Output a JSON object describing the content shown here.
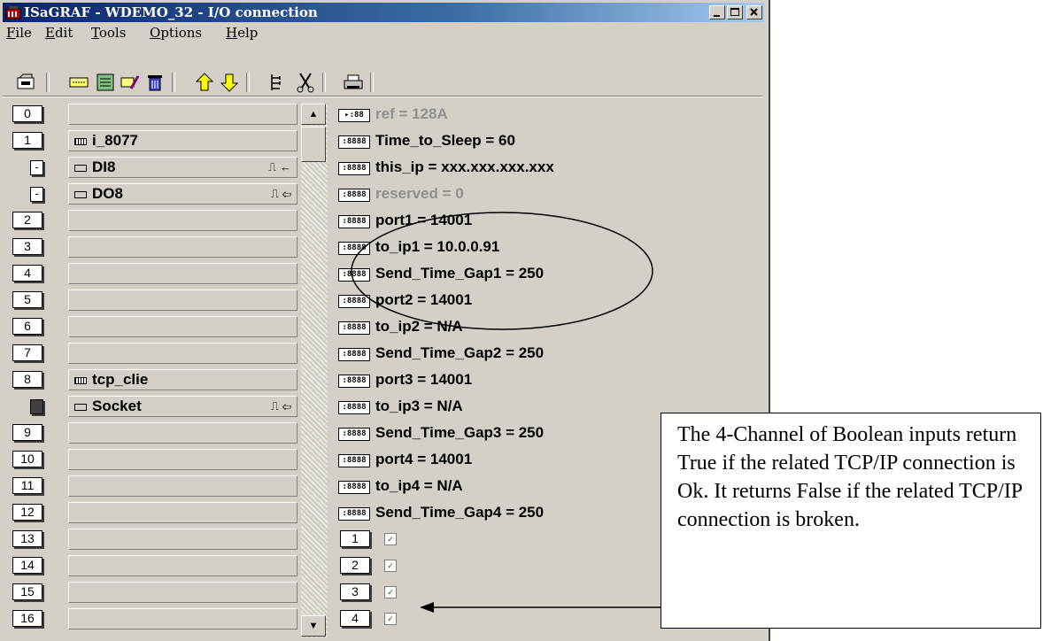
{
  "window": {
    "title": "ISaGRAF - WDEMO_32 - I/O connection",
    "caption_buttons": [
      "minimize-icon",
      "maximize-icon",
      "close-icon"
    ]
  },
  "menu": [
    "File",
    "Edit",
    "Tools",
    "Options",
    "Help"
  ],
  "toolbar": [
    "open-icon",
    "board-icon",
    "variables-icon",
    "edit-icon",
    "delete-icon",
    "up-arrow-icon",
    "down-arrow-icon",
    "tree-icon",
    "cut-icon",
    "print-icon"
  ],
  "slots": [
    {
      "num": "0",
      "name": ""
    },
    {
      "num": "1",
      "name": "i_8077"
    },
    {
      "num": "-",
      "name": "DI8"
    },
    {
      "num": "-",
      "name": "DO8"
    },
    {
      "num": "2",
      "name": ""
    },
    {
      "num": "3",
      "name": ""
    },
    {
      "num": "4",
      "name": ""
    },
    {
      "num": "5",
      "name": ""
    },
    {
      "num": "6",
      "name": ""
    },
    {
      "num": "7",
      "name": ""
    },
    {
      "num": "8",
      "name": "tcp_clie"
    },
    {
      "num": "",
      "name": "Socket"
    },
    {
      "num": "9",
      "name": ""
    },
    {
      "num": "10",
      "name": ""
    },
    {
      "num": "11",
      "name": ""
    },
    {
      "num": "12",
      "name": ""
    },
    {
      "num": "13",
      "name": ""
    },
    {
      "num": "14",
      "name": ""
    },
    {
      "num": "15",
      "name": ""
    },
    {
      "num": "16",
      "name": ""
    }
  ],
  "variables": [
    "ref = 128A",
    "Time_to_Sleep = 60",
    "this_ip = xxx.xxx.xxx.xxx",
    "reserved = 0",
    "port1 = 14001",
    "to_ip1 = 10.0.0.91",
    "Send_Time_Gap1 = 250",
    "port2 = 14001",
    "to_ip2 = N/A",
    "Send_Time_Gap2 = 250",
    "port3 = 14001",
    "to_ip3 = N/A",
    "Send_Time_Gap3 = 250",
    "port4 = 14001",
    "to_ip4 = N/A",
    "Send_Time_Gap4 = 250"
  ],
  "channels": [
    "1",
    "2",
    "3",
    "4"
  ],
  "annotation": "The 4-Channel of Boolean inputs return True if the related TCP/IP connection is Ok. It returns False if the related TCP/IP connection is broken."
}
